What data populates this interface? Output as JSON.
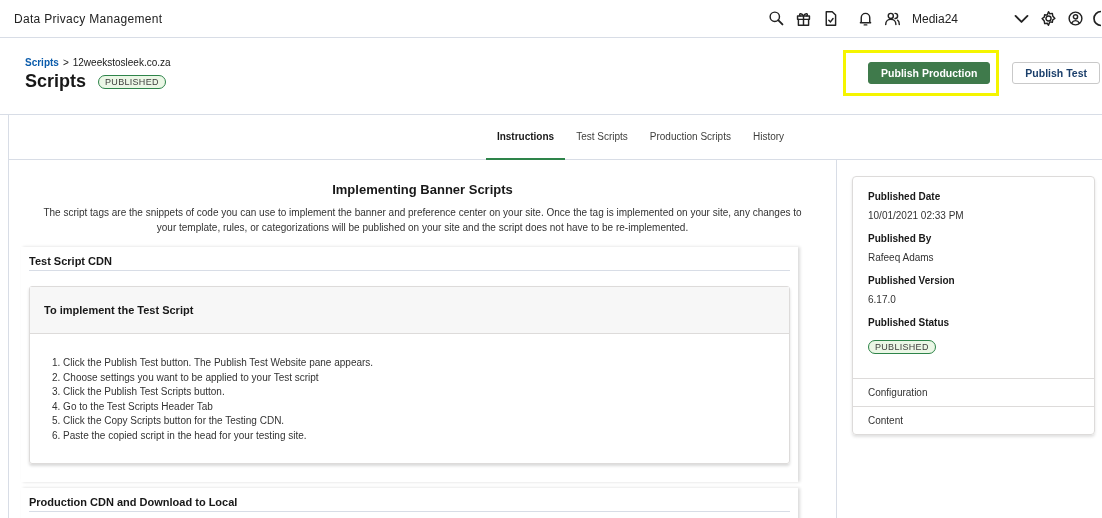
{
  "app": {
    "title": "Data Privacy Management",
    "account": "Media24"
  },
  "breadcrumb": {
    "parent": "Scripts",
    "separator": ">",
    "current": "12weekstosleek.co.za"
  },
  "page": {
    "title": "Scripts",
    "status": "PUBLISHED"
  },
  "actions": [
    {
      "label": "Publish Production",
      "kind": "primary",
      "highlighted": true
    },
    {
      "label": "Publish Test",
      "kind": "secondary",
      "highlighted": false
    }
  ],
  "tabs": [
    {
      "label": "Instructions",
      "selected": true
    },
    {
      "label": "Test Scripts",
      "selected": false
    },
    {
      "label": "Production Scripts",
      "selected": false
    },
    {
      "label": "History",
      "selected": false
    }
  ],
  "intro": {
    "heading": "Implementing Banner Scripts",
    "text": "The script tags are the snippets of code you can use to implement the banner and preference center on your site. Once the tag is implemented on your site, any changes to your template, rules, or categorizations will be published on your site and the script does not have to be re-implemented."
  },
  "sections": [
    {
      "title": "Test Script CDN",
      "card": {
        "title": "To implement the Test Script",
        "steps": [
          "1. Click the Publish Test button. The Publish Test Website pane appears.",
          "2. Choose settings you want to be applied to your Test script",
          "3. Click the Publish Test Scripts button.",
          "4. Go to the Test Scripts Header Tab",
          "5. Click the Copy Scripts button for the Testing CDN.",
          "6. Paste the copied script in the head for your testing site."
        ]
      }
    },
    {
      "title": "Production CDN and Download to Local"
    }
  ],
  "details": {
    "fields": [
      {
        "label": "Published Date",
        "value": "10/01/2021 02:33 PM",
        "kind": "text"
      },
      {
        "label": "Published By",
        "value": "Rafeeq Adams",
        "kind": "text"
      },
      {
        "label": "Published Version",
        "value": "6.17.0",
        "kind": "text"
      },
      {
        "label": "Published Status",
        "value": "PUBLISHED",
        "kind": "badge"
      }
    ],
    "links": [
      "Configuration",
      "Content"
    ]
  }
}
